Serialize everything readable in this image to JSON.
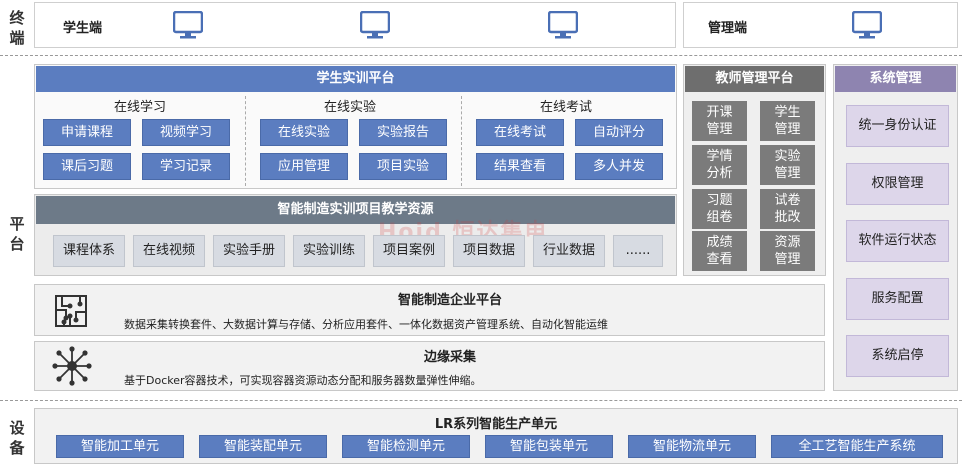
{
  "sections": {
    "terminal": "终端",
    "platform": "平台",
    "device": "设备"
  },
  "terminal": {
    "student_label": "学生端",
    "admin_label": "管理端",
    "icon": "monitor-icon"
  },
  "student_platform": {
    "title": "学生实训平台",
    "groups": [
      {
        "title": "在线学习",
        "buttons": [
          "申请课程",
          "视频学习",
          "课后习题",
          "学习记录"
        ]
      },
      {
        "title": "在线实验",
        "buttons": [
          "在线实验",
          "实验报告",
          "应用管理",
          "项目实验"
        ]
      },
      {
        "title": "在线考试",
        "buttons": [
          "在线考试",
          "自动评分",
          "结果查看",
          "多人并发"
        ]
      }
    ]
  },
  "resources": {
    "title": "智能制造实训项目教学资源",
    "items": [
      "课程体系",
      "在线视频",
      "实验手册",
      "实验训练",
      "项目案例",
      "项目数据",
      "行业数据",
      "......"
    ],
    "watermark": "Hojd 恒达集电"
  },
  "enterprise_platform": {
    "title": "智能制造企业平台",
    "description": "数据采集转换套件、大数据计算与存储、分析应用套件、一体化数据资产管理系统、自动化智能运维",
    "icon": "circuit-icon"
  },
  "edge": {
    "title": "边缘采集",
    "description": "基于Docker容器技术，可实现容器资源动态分配和服务器数量弹性伸缩。",
    "icon": "network-hub-icon"
  },
  "teacher_platform": {
    "title": "教师管理平台",
    "items": [
      [
        "开课",
        "管理"
      ],
      [
        "学生",
        "管理"
      ],
      [
        "学情",
        "分析"
      ],
      [
        "实验",
        "管理"
      ],
      [
        "习题",
        "组卷"
      ],
      [
        "试卷",
        "批改"
      ],
      [
        "成绩",
        "查看"
      ],
      [
        "资源",
        "管理"
      ]
    ]
  },
  "system_mgmt": {
    "title": "系统管理",
    "items": [
      "统一身份认证",
      "权限管理",
      "软件运行状态",
      "服务配置",
      "系统启停"
    ]
  },
  "lr_units": {
    "title": "LR系列智能生产单元",
    "items": [
      "智能加工单元",
      "智能装配单元",
      "智能检测单元",
      "智能包装单元",
      "智能物流单元",
      "全工艺智能生产系统"
    ]
  },
  "colors": {
    "blue": "#5b7dc0",
    "gray": "#7b7b7b",
    "purple": "#8e84b0",
    "light": "#d7dbe2"
  }
}
